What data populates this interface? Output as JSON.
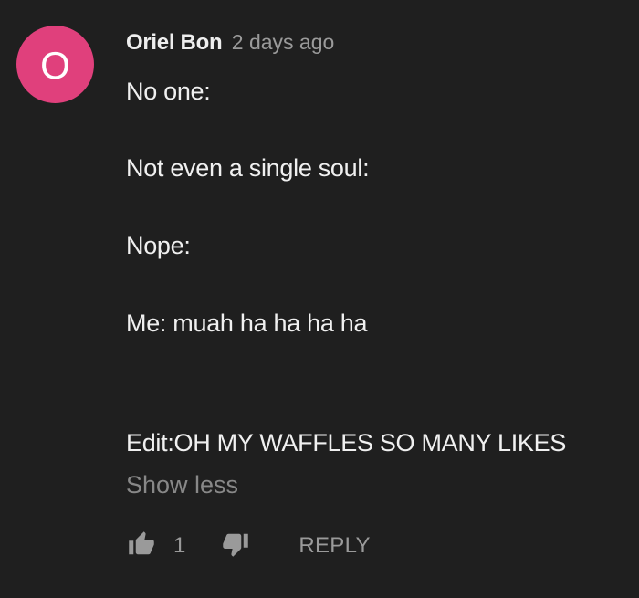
{
  "comment": {
    "avatar_letter": "O",
    "avatar_color": "#e0407c",
    "author": "Oriel Bon",
    "timestamp": "2 days ago",
    "lines": [
      "No one:",
      "Not even a single soul:",
      "Nope:",
      "Me: muah ha ha ha ha",
      "Edit:OH MY WAFFLES SO MANY LIKES"
    ],
    "show_less_label": "Show less",
    "like_count": "1",
    "reply_label": "REPLY",
    "icons": {
      "like": "thumbs-up-icon",
      "dislike": "thumbs-down-icon"
    }
  }
}
